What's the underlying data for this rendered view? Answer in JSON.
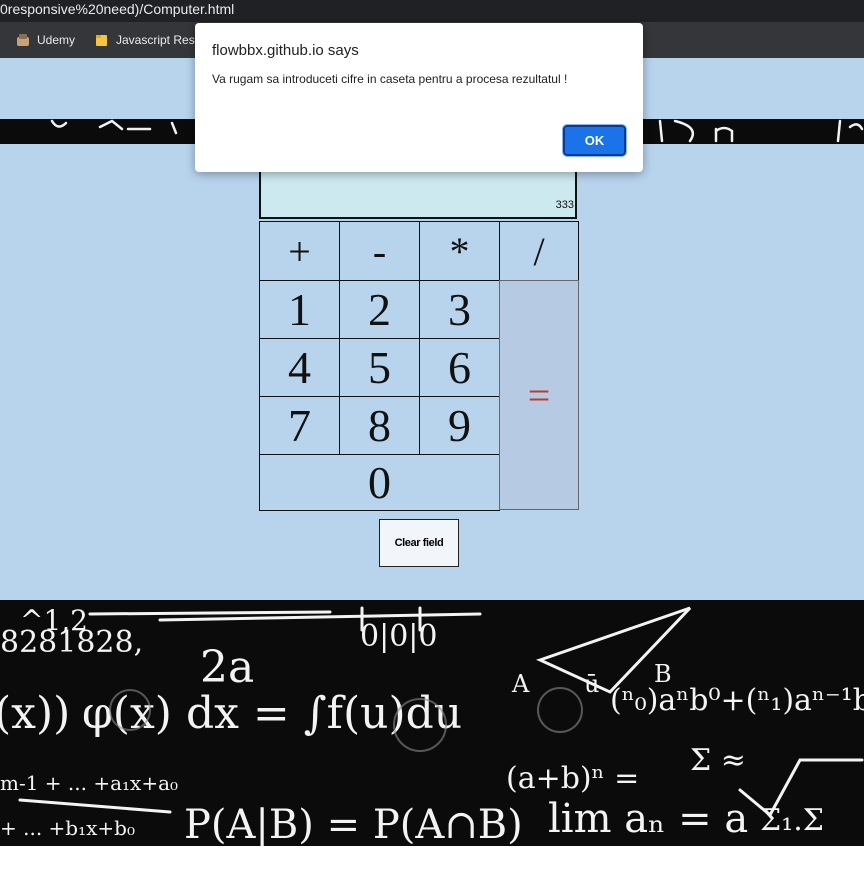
{
  "browser": {
    "url": "0responsive%20need)/Computer.html",
    "bookmarks": [
      {
        "label": "Udemy",
        "icon": "udemy-bookmark-icon"
      },
      {
        "label": "Javascript Reso",
        "icon": "folder-icon"
      }
    ]
  },
  "calculator": {
    "display_value": "333",
    "operators": [
      "+",
      "-",
      "*",
      "/"
    ],
    "digits": [
      "1",
      "2",
      "3",
      "4",
      "5",
      "6",
      "7",
      "8",
      "9",
      "0"
    ],
    "equals": "=",
    "clear_label": "Clear field"
  },
  "background": {
    "formulas": [
      "2a",
      "φ(x) dx = ∫f(u)du",
      "P(A|B) = P(A∩B)",
      "lim aₙ = a",
      "(a+b)ⁿ",
      "0 | 0 | 0",
      "8281828",
      "A",
      "B",
      "σ"
    ]
  },
  "dialog": {
    "origin": "flowbbx.github.io says",
    "message": "Va rugam sa introduceti cifre in caseta pentru a procesa rezultatul !",
    "ok_label": "OK"
  },
  "colors": {
    "page_bg": "#b8d4ed",
    "display_bg": "#cce9ef",
    "equals_color": "#c0392b",
    "ok_button": "#1a73e8"
  }
}
